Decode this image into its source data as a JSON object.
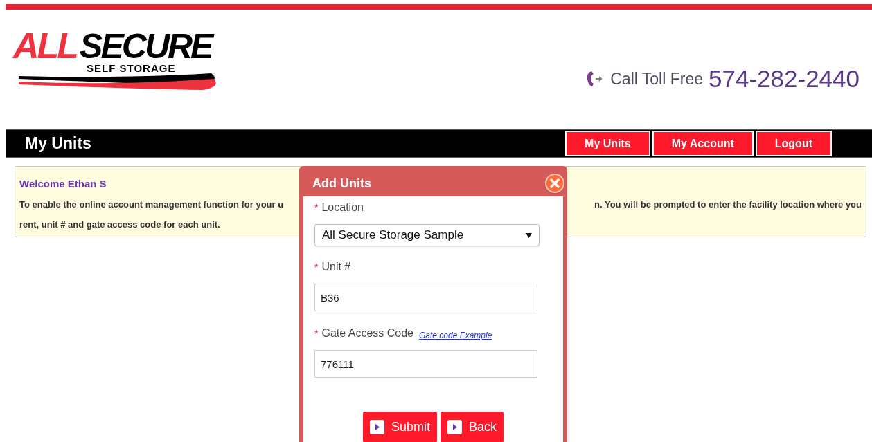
{
  "logo": {
    "word_1": "ALL",
    "word_2": "SECURE",
    "tagline": "SELF STORAGE"
  },
  "phone": {
    "label": "Call Toll Free",
    "number": "574-282-2440"
  },
  "nav": {
    "title": "My Units",
    "buttons": [
      {
        "label": "My Units"
      },
      {
        "label": "My Account"
      },
      {
        "label": "Logout"
      }
    ]
  },
  "welcome": {
    "heading": "Welcome Ethan S",
    "line_1_left": "To enable the online account management function for your u",
    "line_1_right": "n. You will be prompted to enter the facility location where you",
    "line_2": "rent, unit # and gate access code for each unit."
  },
  "dialog": {
    "title": "Add Units",
    "fields": [
      {
        "kind": "select",
        "required_mark": "*",
        "label": "Location",
        "value": "All Secure Storage Sample"
      },
      {
        "kind": "text",
        "required_mark": "*",
        "label": "Unit #",
        "value": "B36"
      },
      {
        "kind": "text",
        "required_mark": "*",
        "label": "Gate Access Code",
        "link": "Gate code Example",
        "value": "776111"
      }
    ],
    "buttons": [
      {
        "label": "Submit"
      },
      {
        "label": "Back"
      }
    ]
  }
}
